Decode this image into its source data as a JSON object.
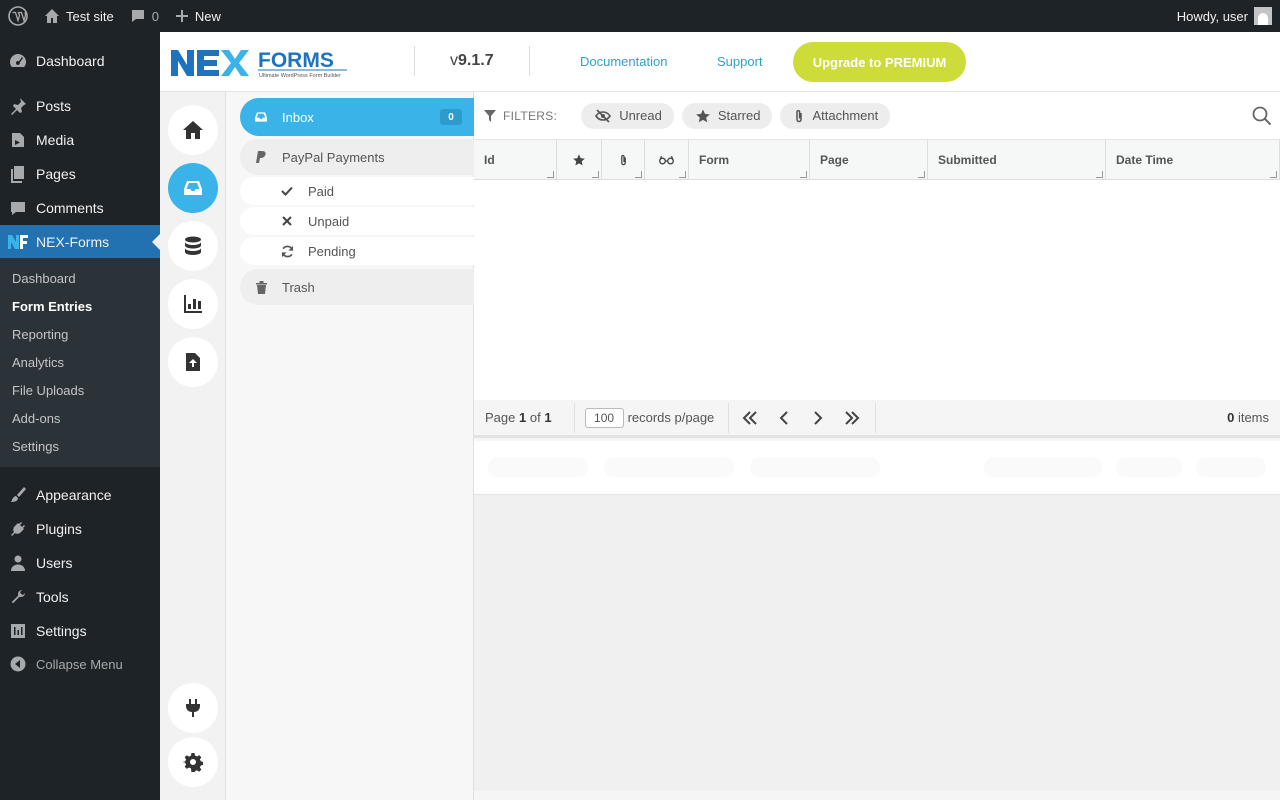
{
  "adminbar": {
    "site_name": "Test site",
    "comments_count": "0",
    "new_label": "New",
    "howdy": "Howdy, user"
  },
  "wp_menu": {
    "items": [
      {
        "label": "Dashboard",
        "icon": "dashboard-icon"
      },
      {
        "label": "Posts",
        "icon": "pushpin-icon"
      },
      {
        "label": "Media",
        "icon": "media-icon"
      },
      {
        "label": "Pages",
        "icon": "pages-icon"
      },
      {
        "label": "Comments",
        "icon": "comments-icon"
      },
      {
        "label": "NEX-Forms",
        "icon": "nex-forms-icon"
      },
      {
        "label": "Appearance",
        "icon": "paintbrush-icon"
      },
      {
        "label": "Plugins",
        "icon": "plugins-icon"
      },
      {
        "label": "Users",
        "icon": "users-icon"
      },
      {
        "label": "Tools",
        "icon": "wrench-icon"
      },
      {
        "label": "Settings",
        "icon": "settings-sliders-icon"
      }
    ],
    "submenu": [
      "Dashboard",
      "Form Entries",
      "Reporting",
      "Analytics",
      "File Uploads",
      "Add-ons",
      "Settings"
    ],
    "collapse_label": "Collapse Menu"
  },
  "nex_header": {
    "logo_text": "NEX FORMS",
    "logo_tagline": "Ultimate WordPress Form Builder",
    "version_prefix": "v",
    "version": "9.1.7",
    "documentation": "Documentation",
    "support": "Support",
    "upgrade": "Upgrade to PREMIUM"
  },
  "folders": {
    "inbox": {
      "label": "Inbox",
      "count": "0"
    },
    "paypal": "PayPal Payments",
    "paid": "Paid",
    "unpaid": "Unpaid",
    "pending": "Pending",
    "trash": "Trash"
  },
  "filters": {
    "label": "FILTERS:",
    "unread": "Unread",
    "starred": "Starred",
    "attachment": "Attachment"
  },
  "table": {
    "columns": [
      "Id",
      "",
      "",
      "",
      "Form",
      "Page",
      "Submitted",
      "Date Time"
    ]
  },
  "pager": {
    "page_word": "Page",
    "current_page": "1",
    "of_word": "of",
    "total_pages": "1",
    "per_page": "100",
    "per_page_label": "records p/page",
    "items_count": "0",
    "items_label": "items"
  },
  "colors": {
    "wp_dark": "#1d2327",
    "wp_blue": "#2271b1",
    "nex_blue": "#39b3e8",
    "premium_green": "#cddc39",
    "link_blue": "#2ea2cc"
  }
}
